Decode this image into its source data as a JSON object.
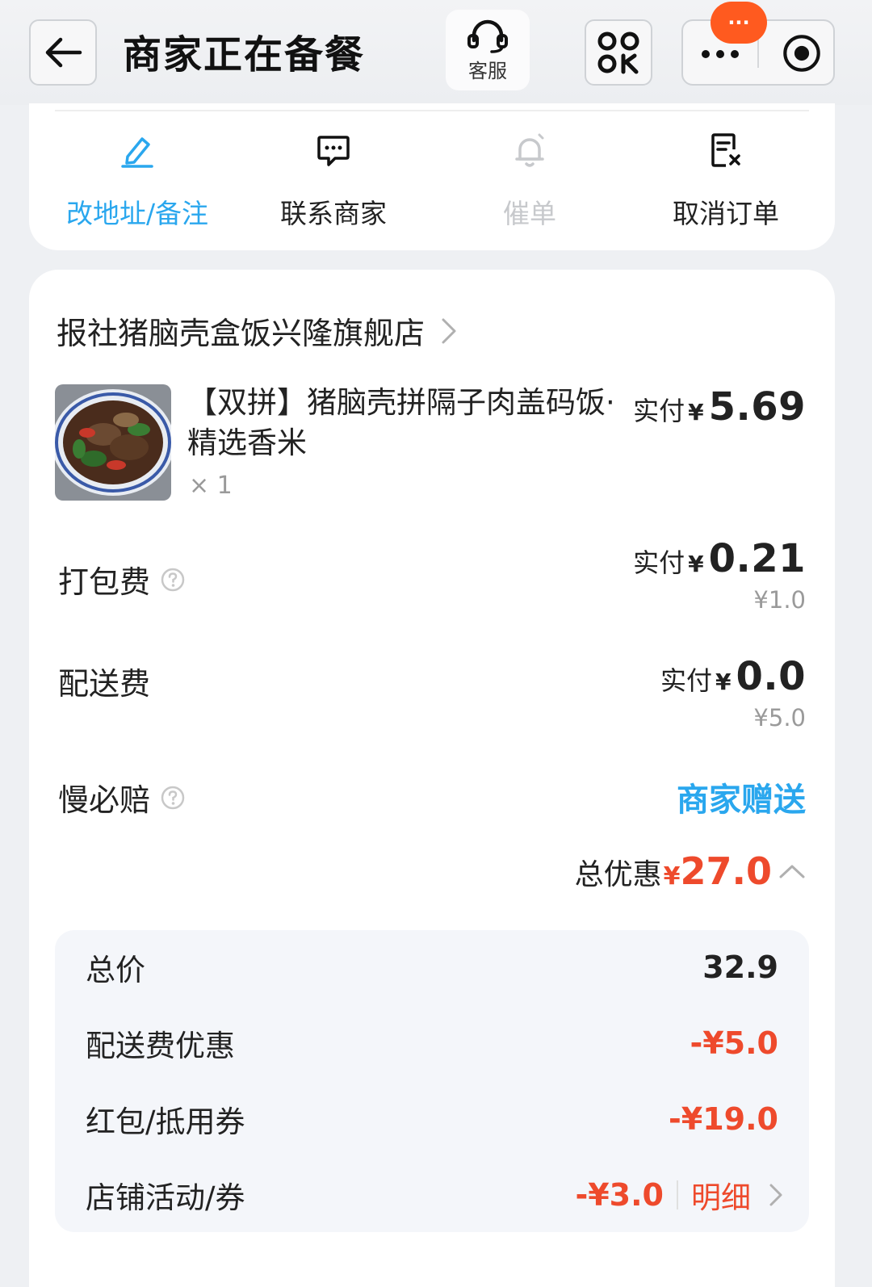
{
  "header": {
    "title": "商家正在备餐",
    "customer_service_label": "客服",
    "notification_badge": "···",
    "icons": [
      "back-arrow-icon",
      "headset-icon",
      "scan-code-icon",
      "more-dots-icon",
      "record-target-icon"
    ]
  },
  "actions": [
    {
      "label": "改地址/备注",
      "icon": "edit-pen-icon",
      "state": "active"
    },
    {
      "label": "联系商家",
      "icon": "chat-bubble-icon",
      "state": "normal"
    },
    {
      "label": "催单",
      "icon": "bell-icon",
      "state": "disabled"
    },
    {
      "label": "取消订单",
      "icon": "cancel-receipt-icon",
      "state": "normal"
    }
  ],
  "order": {
    "shop_name": "报社猪脑壳盒饭兴隆旗舰店",
    "item": {
      "name": "【双拼】猪脑壳拼隔子肉盖码饭·精选香米",
      "quantity": "× 1",
      "pay_label": "实付",
      "currency": "¥",
      "pay_value": "5.69"
    },
    "fees": [
      {
        "label": "打包费",
        "has_help": true,
        "pay_label": "实付",
        "currency": "¥",
        "pay_value": "0.21",
        "original": "¥1.0"
      },
      {
        "label": "配送费",
        "has_help": false,
        "pay_label": "实付",
        "currency": "¥",
        "pay_value": "0.0",
        "original": "¥5.0"
      }
    ],
    "slow_compensation": {
      "label": "慢必赔",
      "value": "商家赠送"
    },
    "discount_summary": {
      "label": "总优惠",
      "currency": "¥",
      "value": "27.0"
    },
    "breakdown": [
      {
        "label": "总价",
        "value": "32.9"
      },
      {
        "label": "配送费优惠",
        "value": "-¥5.0"
      },
      {
        "label": "红包/抵用券",
        "value": "-¥19.0"
      },
      {
        "label": "店铺活动/券",
        "value": "-¥3.0",
        "detail": "明细"
      }
    ]
  },
  "colors": {
    "accent_blue": "#2aa7ee",
    "discount_red": "#ee4a2c",
    "badge_orange": "#ff5a1f",
    "page_bg": "#eef0f3"
  }
}
